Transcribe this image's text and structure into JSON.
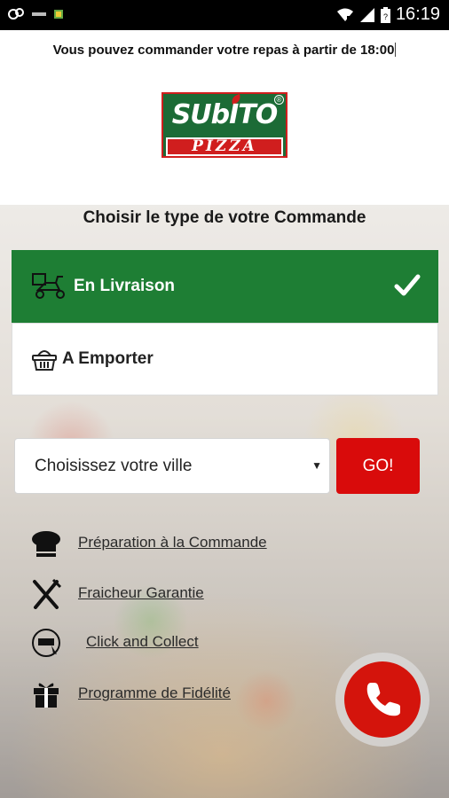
{
  "status_bar": {
    "time": "16:19",
    "left_icons": [
      "cloud-sync-icon",
      "app-notification-icon",
      "app-notification-icon"
    ],
    "right_icons": [
      "wifi-icon",
      "signal-icon",
      "battery-icon"
    ]
  },
  "header": {
    "notice": "Vous pouvez commander votre repas à partir de 18:00"
  },
  "logo": {
    "top_text": "SUbITO",
    "bottom_text": "PIZZA",
    "registered_mark": "®",
    "colors": {
      "green": "#1c6b36",
      "red": "#d01e1e"
    }
  },
  "order_type": {
    "title": "Choisir le type de votre Commande",
    "options": [
      {
        "label": "En Livraison",
        "icon": "delivery-scooter-icon",
        "selected": true
      },
      {
        "label": "A Emporter",
        "icon": "basket-icon",
        "selected": false
      }
    ]
  },
  "city": {
    "selected": "Choisissez votre ville",
    "go_label": "GO!"
  },
  "features": [
    {
      "label": "Préparation à la Commande",
      "icon": "chef-hat-icon"
    },
    {
      "label": "Fraicheur Garantie",
      "icon": "fork-knife-icon"
    },
    {
      "label": "Click and Collect",
      "icon": "click-collect-icon"
    },
    {
      "label": "Programme de Fidélité",
      "icon": "gift-icon"
    }
  ],
  "colors": {
    "accent_green": "#1e7e34",
    "accent_red": "#d90b0b"
  }
}
